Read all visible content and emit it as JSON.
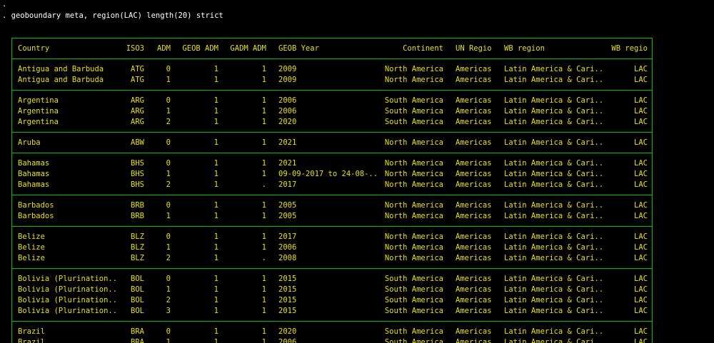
{
  "console": {
    "prompt": ".",
    "command": ". geoboundary meta, region(LAC) length(20) strict"
  },
  "table": {
    "headers": [
      "Country",
      "ISO3",
      "ADM",
      "GEOB ADM",
      "GADM ADM",
      "GEOB Year",
      "Continent",
      "UN Regio",
      "WB region",
      "WB regio"
    ],
    "groups": [
      [
        [
          "Antigua and Barbuda",
          "ATG",
          "0",
          "1",
          "1",
          "2009",
          "North America",
          "Americas",
          "Latin America & Cari..",
          "LAC"
        ],
        [
          "Antigua and Barbuda",
          "ATG",
          "1",
          "1",
          "1",
          "2009",
          "North America",
          "Americas",
          "Latin America & Cari..",
          "LAC"
        ]
      ],
      [
        [
          "Argentina",
          "ARG",
          "0",
          "1",
          "1",
          "2006",
          "South America",
          "Americas",
          "Latin America & Cari..",
          "LAC"
        ],
        [
          "Argentina",
          "ARG",
          "1",
          "1",
          "1",
          "2006",
          "South America",
          "Americas",
          "Latin America & Cari..",
          "LAC"
        ],
        [
          "Argentina",
          "ARG",
          "2",
          "1",
          "1",
          "2020",
          "South America",
          "Americas",
          "Latin America & Cari..",
          "LAC"
        ]
      ],
      [
        [
          "Aruba",
          "ABW",
          "0",
          "1",
          "1",
          "2021",
          "North America",
          "Americas",
          "Latin America & Cari..",
          "LAC"
        ]
      ],
      [
        [
          "Bahamas",
          "BHS",
          "0",
          "1",
          "1",
          "2021",
          "North America",
          "Americas",
          "Latin America & Cari..",
          "LAC"
        ],
        [
          "Bahamas",
          "BHS",
          "1",
          "1",
          "1",
          "09-09-2017 to 24-08-..",
          "North America",
          "Americas",
          "Latin America & Cari..",
          "LAC"
        ],
        [
          "Bahamas",
          "BHS",
          "2",
          "1",
          ".",
          "2017",
          "North America",
          "Americas",
          "Latin America & Cari..",
          "LAC"
        ]
      ],
      [
        [
          "Barbados",
          "BRB",
          "0",
          "1",
          "1",
          "2005",
          "North America",
          "Americas",
          "Latin America & Cari..",
          "LAC"
        ],
        [
          "Barbados",
          "BRB",
          "1",
          "1",
          "1",
          "2005",
          "North America",
          "Americas",
          "Latin America & Cari..",
          "LAC"
        ]
      ],
      [
        [
          "Belize",
          "BLZ",
          "0",
          "1",
          "1",
          "2017",
          "North America",
          "Americas",
          "Latin America & Cari..",
          "LAC"
        ],
        [
          "Belize",
          "BLZ",
          "1",
          "1",
          "1",
          "2006",
          "North America",
          "Americas",
          "Latin America & Cari..",
          "LAC"
        ],
        [
          "Belize",
          "BLZ",
          "2",
          "1",
          ".",
          "2008",
          "North America",
          "Americas",
          "Latin America & Cari..",
          "LAC"
        ]
      ],
      [
        [
          "Bolivia (Plurination..",
          "BOL",
          "0",
          "1",
          "1",
          "2015",
          "South America",
          "Americas",
          "Latin America & Cari..",
          "LAC"
        ],
        [
          "Bolivia (Plurination..",
          "BOL",
          "1",
          "1",
          "1",
          "2015",
          "South America",
          "Americas",
          "Latin America & Cari..",
          "LAC"
        ],
        [
          "Bolivia (Plurination..",
          "BOL",
          "2",
          "1",
          "1",
          "2015",
          "South America",
          "Americas",
          "Latin America & Cari..",
          "LAC"
        ],
        [
          "Bolivia (Plurination..",
          "BOL",
          "3",
          "1",
          "1",
          "2015",
          "South America",
          "Americas",
          "Latin America & Cari..",
          "LAC"
        ]
      ],
      [
        [
          "Brazil",
          "BRA",
          "0",
          "1",
          "1",
          "2020",
          "South America",
          "Americas",
          "Latin America & Cari..",
          "LAC"
        ],
        [
          "Brazil",
          "BRA",
          "1",
          "1",
          "1",
          "2006",
          "South America",
          "Americas",
          "Latin America & Cari..",
          "LAC"
        ]
      ]
    ]
  },
  "colors": {
    "background": "#000000",
    "text": "#e8e000",
    "border": "#00c000",
    "command": "#ffffff"
  }
}
